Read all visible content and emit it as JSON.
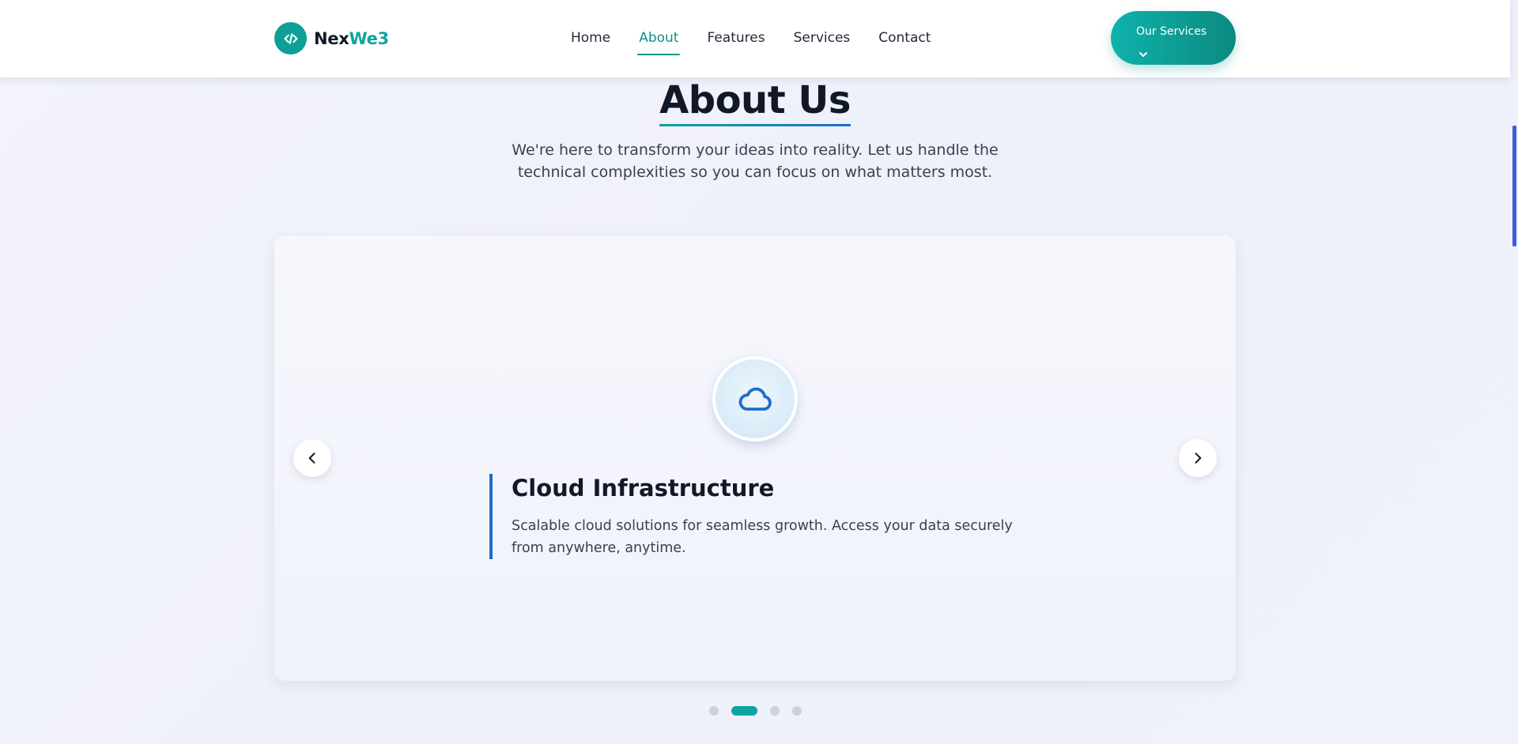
{
  "header": {
    "logo": {
      "part1": "Nex",
      "part2": "We3",
      "icon": "code-icon"
    },
    "nav": [
      {
        "label": "Home",
        "active": false
      },
      {
        "label": "About",
        "active": true
      },
      {
        "label": "Features",
        "active": false
      },
      {
        "label": "Services",
        "active": false
      },
      {
        "label": "Contact",
        "active": false
      }
    ],
    "cta_label": "Our Services",
    "cta_icon": "chevron-down-icon"
  },
  "section": {
    "title": "About Us",
    "subtitle": "We're here to transform your ideas into reality. Let us handle the technical complexities so you can focus on what matters most."
  },
  "carousel": {
    "active_index": 1,
    "slide_count": 4,
    "slide": {
      "icon": "cloud-icon",
      "title": "Cloud Infrastructure",
      "description": "Scalable cloud solutions for seamless growth. Access your data securely from anywhere, anytime."
    },
    "prev_icon": "chevron-left-icon",
    "next_icon": "chevron-right-icon"
  },
  "colors": {
    "accent": "#0ea5a0",
    "accent_dark": "#0d9488",
    "blue": "#1d6fc8",
    "scrollbar": "#3b5bdb"
  }
}
